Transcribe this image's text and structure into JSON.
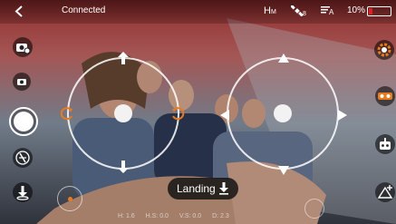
{
  "topbar": {
    "connection_status": "Connected",
    "headless_mode": "H",
    "headless_sub": "M",
    "gps_count": "8",
    "signal_label": "A",
    "battery_percent": "10%"
  },
  "landing_button": {
    "label": "Landing"
  },
  "telemetry": {
    "altitude": "H: 1.6",
    "horizontal_speed": "H.S: 0.0",
    "vertical_speed": "V.S: 0.0",
    "distance": "D: 2.3"
  },
  "colors": {
    "accent": "#e04020",
    "battery_fill": "#e02020",
    "overlay": "#00000080"
  },
  "icons": {
    "back": "chevron-left-icon",
    "gps": "satellite-icon",
    "signal": "signal-icon",
    "battery": "battery-icon",
    "photo": "camera-icon",
    "video": "video-icon",
    "shutter": "shutter-icon",
    "flight_mode": "flight-mode-icon",
    "takeoff": "takeoff-icon",
    "settings": "gear-icon",
    "vr": "vr-glasses-icon",
    "robot": "robot-icon",
    "calibrate": "calibrate-icon"
  }
}
